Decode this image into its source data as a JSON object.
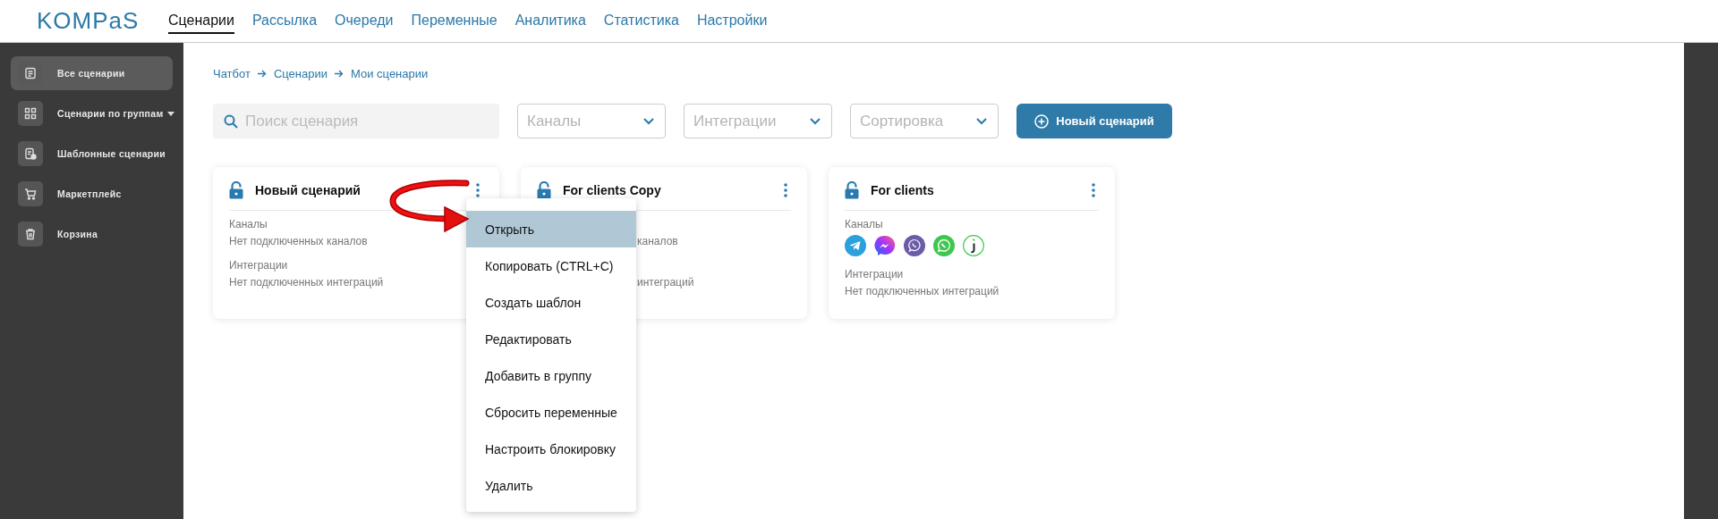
{
  "logo": "KOMPaS",
  "nav": [
    {
      "label": "Сценарии",
      "selected": true
    },
    {
      "label": "Рассылка",
      "selected": false
    },
    {
      "label": "Очереди",
      "selected": false
    },
    {
      "label": "Переменные",
      "selected": false
    },
    {
      "label": "Аналитика",
      "selected": false
    },
    {
      "label": "Статистика",
      "selected": false
    },
    {
      "label": "Настройки",
      "selected": false
    }
  ],
  "sidebar": {
    "items": [
      {
        "label": "Все сценарии",
        "kind": "doc",
        "selected": true,
        "has_caret": false
      },
      {
        "label": "Сценарии по группам",
        "kind": "grid",
        "selected": false,
        "has_caret": true
      },
      {
        "label": "Шаблонные сценарии",
        "kind": "template",
        "selected": false,
        "has_caret": false
      },
      {
        "label": "Маркетплейс",
        "kind": "cart",
        "selected": false,
        "has_caret": false
      },
      {
        "label": "Корзина",
        "kind": "trash",
        "selected": false,
        "has_caret": false
      }
    ]
  },
  "breadcrumb": [
    "Чатбот",
    "Сценарии",
    "Мои сценарии"
  ],
  "search": {
    "placeholder": "Поиск сценария"
  },
  "filters": [
    {
      "placeholder": "Каналы"
    },
    {
      "placeholder": "Интеграции"
    },
    {
      "placeholder": "Сортировка"
    }
  ],
  "new_button": "Новый сценарий",
  "cards": [
    {
      "title": "Новый сценарий",
      "channels_label": "Каналы",
      "channels_text": "Нет подключенных каналов",
      "integrations_label": "Интеграции",
      "integrations_text": "Нет подключенных интеграций"
    },
    {
      "title": "For clients Copy",
      "channels_text": "каналов",
      "integrations_text": "интеграций"
    },
    {
      "title": "For clients",
      "channels_label": "Каналы",
      "channels": [
        {
          "kind": "plane"
        },
        {
          "kind": "bolt"
        },
        {
          "kind": "phone-violet"
        },
        {
          "kind": "phone-green"
        },
        {
          "kind": "hook"
        }
      ],
      "integrations_label": "Интеграции",
      "integrations_text": "Нет подключенных интеграций"
    }
  ],
  "context_menu": [
    {
      "label": "Открыть",
      "selected": true
    },
    {
      "label": "Копировать (CTRL+C)",
      "selected": false
    },
    {
      "label": "Создать шаблон",
      "selected": false
    },
    {
      "label": "Редактировать",
      "selected": false
    },
    {
      "label": "Добавить в группу",
      "selected": false
    },
    {
      "label": "Сбросить переменные",
      "selected": false
    },
    {
      "label": "Настроить блокировку",
      "selected": false
    },
    {
      "label": "Удалить",
      "selected": false
    }
  ]
}
